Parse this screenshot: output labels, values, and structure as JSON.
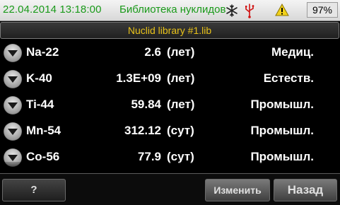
{
  "status": {
    "datetime": "22.04.2014  13:18:00",
    "title": "Библиотека нуклидов",
    "icons": [
      "snowflake-icon",
      "usb-icon",
      "warning-icon"
    ],
    "battery": "97%"
  },
  "header": {
    "library": "Nuclid library #1.lib"
  },
  "rows": [
    {
      "nuclide": "Na-22",
      "value": "2.6",
      "unit": "(лет)",
      "type": "Медиц."
    },
    {
      "nuclide": "K-40",
      "value": "1.3E+09",
      "unit": "(лет)",
      "type": "Естеств."
    },
    {
      "nuclide": "Ti-44",
      "value": "59.84",
      "unit": "(лет)",
      "type": "Промышл."
    },
    {
      "nuclide": "Mn-54",
      "value": "312.12",
      "unit": "(сут)",
      "type": "Промышл."
    },
    {
      "nuclide": "Co-56",
      "value": "77.9",
      "unit": "(сут)",
      "type": "Промышл."
    }
  ],
  "footer": {
    "help_label": "?",
    "edit_label": "Изменить",
    "back_label": "Назад"
  },
  "colors": {
    "status_text": "#1a9a1a",
    "header_text": "#e8c21a",
    "usb": "#d01010",
    "warning": "#f2d21a"
  }
}
